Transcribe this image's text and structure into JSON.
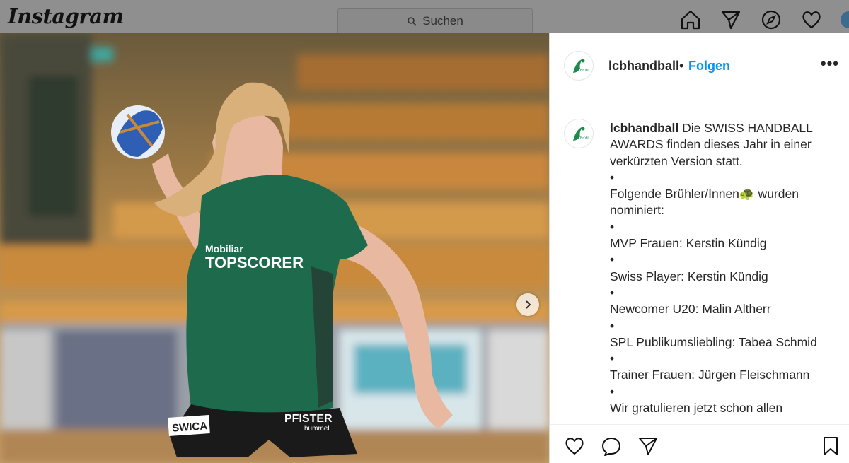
{
  "header": {
    "logo": "Instagram",
    "search_placeholder": "Suchen",
    "nav_icons": [
      "home-icon",
      "direct-icon",
      "explore-icon",
      "activity-icon",
      "profile-avatar"
    ]
  },
  "post": {
    "username": "lcbhandball",
    "separator": "•",
    "follow_label": "Folgen",
    "more_label": "•••",
    "caption": {
      "username": "lcbhandball",
      "lines": [
        "Die SWISS HANDBALL",
        "AWARDS finden dieses Jahr in einer",
        "verkürzten Version statt.",
        "•",
        "Folgende Brühler/Innen🐢 wurden",
        "nominiert:",
        "•",
        "MVP Frauen: Kerstin Kündig",
        "•",
        "Swiss Player: Kerstin Kündig",
        "•",
        "Newcomer U20: Malin Altherr",
        "•",
        "SPL Publikumsliebling: Tabea Schmid",
        "•",
        "Trainer Frauen: Jürgen Fleischmann",
        "•",
        "Wir gratulieren jetzt schon allen"
      ]
    },
    "photo": {
      "jersey_sponsor": "Mobiliar",
      "jersey_text": "TOPSCORER",
      "shorts_sponsor_left": "SWICA",
      "shorts_sponsor_right": "PFISTER",
      "shorts_brand": "hummel"
    }
  },
  "colors": {
    "link": "#0095f6",
    "jersey": "#1d6b4c",
    "text": "#262626"
  }
}
